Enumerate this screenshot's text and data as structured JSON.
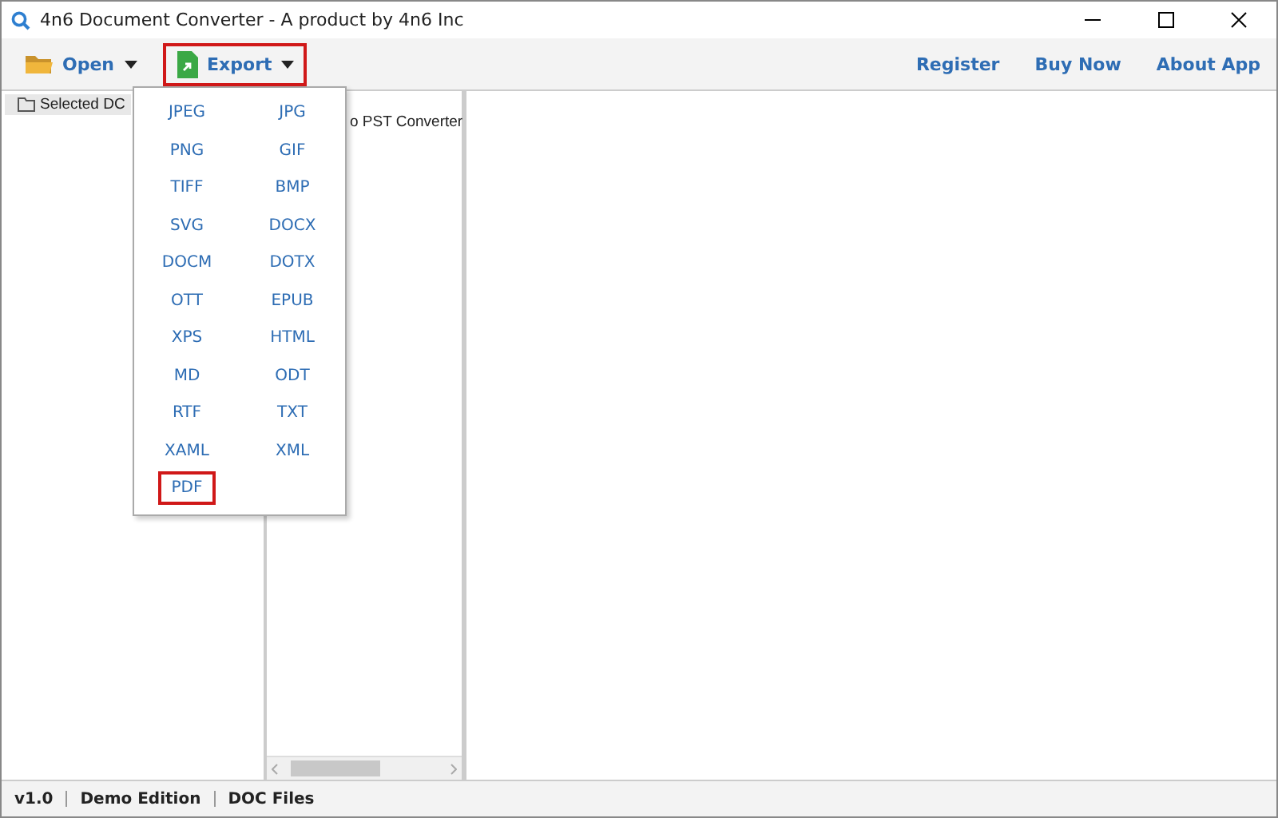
{
  "window": {
    "title": "4n6 Document Converter - A product by 4n6 Inc"
  },
  "toolbar": {
    "buttons": [
      {
        "label": "Open",
        "kind": "open",
        "highlighted": false
      },
      {
        "label": "Export",
        "kind": "export",
        "highlighted": true
      }
    ],
    "links": [
      "Register",
      "Buy Now",
      "About App"
    ]
  },
  "tree": {
    "root": "Selected DC"
  },
  "list_panel": {
    "row": "o PST Converter"
  },
  "export_menu": [
    {
      "label": "JPEG",
      "highlighted": false
    },
    {
      "label": "JPG",
      "highlighted": false
    },
    {
      "label": "PNG",
      "highlighted": false
    },
    {
      "label": "GIF",
      "highlighted": false
    },
    {
      "label": "TIFF",
      "highlighted": false
    },
    {
      "label": "BMP",
      "highlighted": false
    },
    {
      "label": "SVG",
      "highlighted": false
    },
    {
      "label": "DOCX",
      "highlighted": false
    },
    {
      "label": "DOCM",
      "highlighted": false
    },
    {
      "label": "DOTX",
      "highlighted": false
    },
    {
      "label": "OTT",
      "highlighted": false
    },
    {
      "label": "EPUB",
      "highlighted": false
    },
    {
      "label": "XPS",
      "highlighted": false
    },
    {
      "label": "HTML",
      "highlighted": false
    },
    {
      "label": "MD",
      "highlighted": false
    },
    {
      "label": "ODT",
      "highlighted": false
    },
    {
      "label": "RTF",
      "highlighted": false
    },
    {
      "label": "TXT",
      "highlighted": false
    },
    {
      "label": "XAML",
      "highlighted": false
    },
    {
      "label": "XML",
      "highlighted": false
    },
    {
      "label": "PDF",
      "highlighted": true
    }
  ],
  "status_bar": [
    "v1.0",
    "Demo Edition",
    "DOC Files"
  ]
}
